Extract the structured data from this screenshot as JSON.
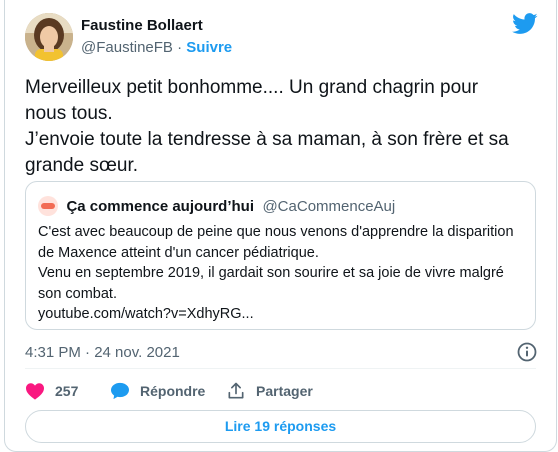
{
  "author": {
    "name": "Faustine Bollaert",
    "handle": "@FaustineFB",
    "separator": "·",
    "follow_label": "Suivre"
  },
  "tweet": {
    "lines": [
      "Merveilleux petit bonhomme.... Un grand chagrin pour",
      "nous tous.",
      "J’envoie toute la tendresse à sa maman, à son frère et sa",
      "grande sœur."
    ]
  },
  "quoted_tweet": {
    "name": "Ça commence aujourd’hui",
    "handle": "@CaCommenceAuj",
    "lines": [
      "C'est avec beaucoup de peine que nous venons d'apprendre la disparition",
      "de Maxence atteint d'un cancer pédiatrique.",
      "Venu en septembre 2019, il gardait son sourire et sa joie de vivre malgré",
      "son combat."
    ],
    "link": "youtube.com/watch?v=XdhyRG..."
  },
  "meta": {
    "timestamp": "4:31 PM · 24 nov. 2021"
  },
  "actions": {
    "like_count": "257",
    "reply_label": "Répondre",
    "share_label": "Partager"
  },
  "read_replies_label": "Lire 19 réponses",
  "icons": {
    "logo": "twitter-bird-icon",
    "info": "info-icon",
    "like": "heart-icon",
    "reply": "speech-bubble-icon",
    "share": "share-upload-icon"
  },
  "colors": {
    "accent": "#1d9bf0",
    "like": "#f91880",
    "secondary_text": "#536471",
    "border": "#cfd9de"
  }
}
